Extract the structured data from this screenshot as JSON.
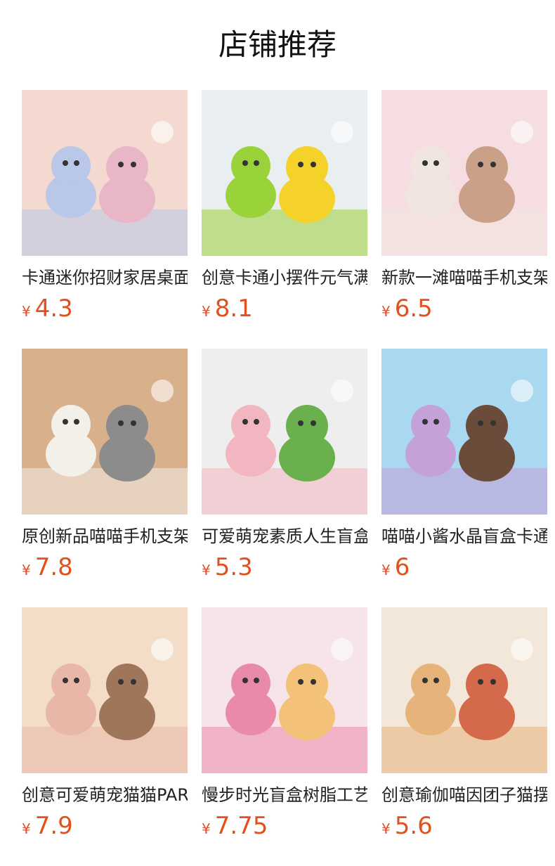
{
  "header": {
    "title": "店铺推荐"
  },
  "currency": "¥",
  "products": [
    {
      "name": "卡通迷你招财家居桌面摆件",
      "price": "4.3",
      "colors": [
        "#f3d9cf",
        "#b9c7e8",
        "#e9b6c8"
      ]
    },
    {
      "name": "创意卡通小摆件元气满满",
      "price": "8.1",
      "colors": [
        "#e9eef0",
        "#9ad23a",
        "#f4d22a"
      ]
    },
    {
      "name": "新款一滩喵喵手机支架",
      "price": "6.5",
      "colors": [
        "#f6dde2",
        "#f0e6df",
        "#caa088"
      ]
    },
    {
      "name": "原创新品喵喵手机支架",
      "price": "7.8",
      "colors": [
        "#d9b08c",
        "#f3efe9",
        "#8c8c8c"
      ]
    },
    {
      "name": "可爱萌宠素质人生盲盒",
      "price": "5.3",
      "colors": [
        "#eeeeee",
        "#f2b6c1",
        "#6ab04c"
      ]
    },
    {
      "name": "喵喵小酱水晶盲盒卡通",
      "price": "6",
      "colors": [
        "#a9d8f0",
        "#c4a1d9",
        "#6b4b3a"
      ]
    },
    {
      "name": "创意可爱萌宠猫猫PARTY",
      "price": "7.9",
      "colors": [
        "#f3ddc8",
        "#e8b7a8",
        "#a0765a"
      ]
    },
    {
      "name": "慢步时光盲盒树脂工艺",
      "price": "7.75",
      "colors": [
        "#f6e4e8",
        "#e98aa8",
        "#f3c178"
      ]
    },
    {
      "name": "创意瑜伽喵因团子猫摆件",
      "price": "5.6",
      "colors": [
        "#f2e7d8",
        "#e6b37b",
        "#d46a4b"
      ]
    }
  ]
}
